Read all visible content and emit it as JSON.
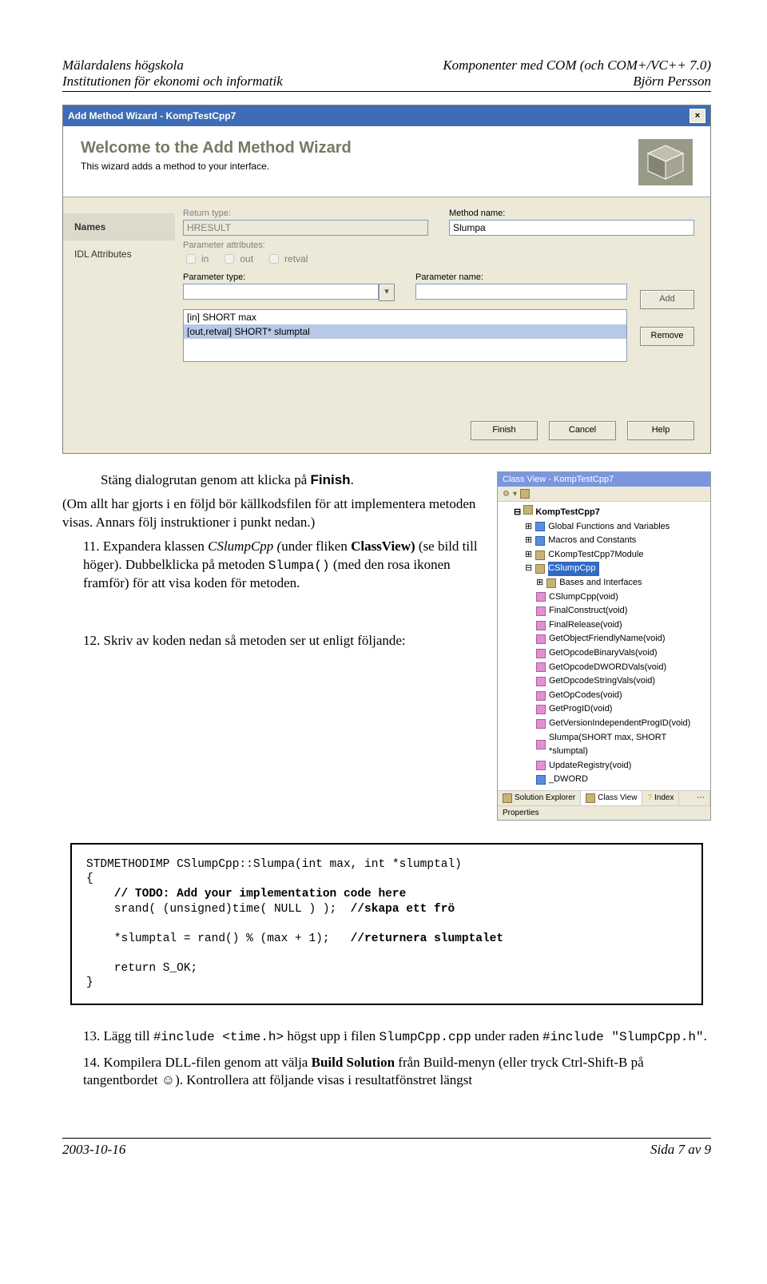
{
  "header": {
    "left1": "Mälardalens högskola",
    "right1": "Komponenter med COM (och COM+/VC++ 7.0)",
    "left2": "Institutionen för ekonomi och informatik",
    "right2": "Björn Persson"
  },
  "wizard": {
    "title": "Add Method Wizard - KompTestCpp7",
    "welcome": "Welcome to the Add Method Wizard",
    "subtitle": "This wizard adds a method to your interface.",
    "sidebar": {
      "names": "Names",
      "idl": "IDL Attributes"
    },
    "labels": {
      "return_type": "Return type:",
      "method_name": "Method name:",
      "param_attr": "Parameter attributes:",
      "in": "in",
      "out": "out",
      "retval": "retval",
      "param_type": "Parameter type:",
      "param_name": "Parameter name:"
    },
    "values": {
      "return_type": "HRESULT",
      "method_name": "Slumpa",
      "param_type": "",
      "param_name": ""
    },
    "list": {
      "r1": "[in] SHORT max",
      "r2": "[out,retval] SHORT* slumptal"
    },
    "buttons": {
      "add": "Add",
      "remove": "Remove",
      "finish": "Finish",
      "cancel": "Cancel",
      "help": "Help"
    }
  },
  "body": {
    "p1a": "Stäng dialogrutan genom att klicka på ",
    "p1b": "Finish",
    "p2": "(Om allt har gjorts i en följd bör källkodsfilen för att implementera metoden visas. Annars följ instruktioner i punkt nedan.)",
    "li11_num": "11.",
    "li11a": " Expandera klassen ",
    "li11b": "CSlumpCpp (",
    "li11c": "under fliken ",
    "li11d": "ClassView)",
    "li11e": " (se bild till höger). Dubbelklicka på metoden ",
    "li11f": "Slumpa()",
    "li11g": " (med den rosa ikonen framför) för att visa koden för metoden.",
    "li12_num": "12.",
    "li12": " Skriv av koden nedan så metoden ser ut enligt följande:",
    "li13_num": "13.",
    "li13a": " Lägg till ",
    "li13b": "#include <time.h>",
    "li13c": " högst upp i filen ",
    "li13d": "SlumpCpp.cpp",
    "li13e": " under raden ",
    "li13f": "#include \"SlumpCpp.h\"",
    "li13g": ".",
    "li14_num": "14.",
    "li14a": " Kompilera DLL-filen genom att välja ",
    "li14b": "Build Solution",
    "li14c": " från Build-menyn (eller tryck Ctrl-Shift-B på tangentbordet ☺). Kontrollera att följande visas i resultatfönstret längst"
  },
  "classview": {
    "title": "Class View - KompTestCpp7",
    "root": "KompTestCpp7",
    "nodes": {
      "globals": "Global Functions and Variables",
      "macros": "Macros and Constants",
      "module": "CKompTestCpp7Module",
      "cslump": "CSlumpCpp",
      "bases": "Bases and Interfaces",
      "ctor": "CSlumpCpp(void)",
      "finalc": "FinalConstruct(void)",
      "finalr": "FinalRelease(void)",
      "friendly": "GetObjectFriendlyName(void)",
      "opbin": "GetOpcodeBinaryVals(void)",
      "opdword": "GetOpcodeDWORDVals(void)",
      "opstr": "GetOpcodeStringVals(void)",
      "opcodes": "GetOpCodes(void)",
      "progid": "GetProgID(void)",
      "verind": "GetVersionIndependentProgID(void)",
      "slumpa": "Slumpa(SHORT max, SHORT *slumptal)",
      "update": "UpdateRegistry(void)",
      "dword": "_DWORD"
    },
    "tabs": {
      "sol": "Solution Explorer",
      "cv": "Class View",
      "idx": "Index"
    },
    "properties": "Properties"
  },
  "code": {
    "l1": "STDMETHODIMP CSlumpCpp::Slumpa(int max, int *slumptal)",
    "l2": "{",
    "l3": "    // TODO: Add your implementation code here",
    "l4a": "    srand( (unsigned)time( NULL ) );  ",
    "l4b": "//skapa ett frö",
    "l5": "",
    "l6a": "    *slumptal = rand() % (max + 1);   ",
    "l6b": "//returnera slumptalet",
    "l7": "",
    "l8": "    return S_OK;",
    "l9": "}"
  },
  "footer": {
    "left": "2003-10-16",
    "right": "Sida 7 av 9"
  }
}
